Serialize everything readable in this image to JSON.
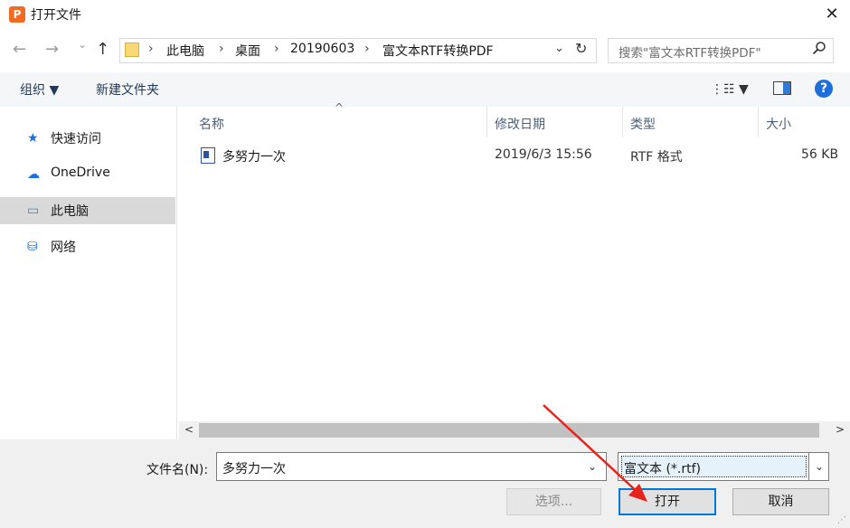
{
  "window": {
    "title": "打开文件",
    "app_icon_letter": "P",
    "app_icon_color": "#f36a21"
  },
  "nav": {
    "back": "←",
    "forward": "→",
    "recent": "⌄",
    "up": "↑",
    "breadcrumb": [
      "此电脑",
      "桌面",
      "20190603",
      "富文本RTF转换PDF"
    ],
    "separator": "›",
    "dropdown": "⌄",
    "refresh": "↻",
    "search_placeholder": "搜索\"富文本RTF转换PDF\"",
    "search_icon": "⌕"
  },
  "toolbar": {
    "organize": "组织 ▼",
    "new_folder": "新建文件夹",
    "view": "⋮☷ ▼",
    "help": "?"
  },
  "sidebar": {
    "items": [
      {
        "label": "快速访问",
        "icon": "★",
        "color": "#1e6fd9"
      },
      {
        "label": "OneDrive",
        "icon": "☁",
        "color": "#1e6fd9"
      },
      {
        "label": "此电脑",
        "icon": "▭",
        "color": "#1e8fd9"
      },
      {
        "label": "网络",
        "icon": "⛁",
        "color": "#1e6fd9"
      }
    ]
  },
  "files": {
    "columns": [
      "名称",
      "修改日期",
      "类型",
      "大小"
    ],
    "sort_caret": "^",
    "rows": [
      {
        "name": "多努力一次",
        "modified": "2019/6/3 15:56",
        "type": "RTF 格式",
        "size": "56 KB"
      }
    ]
  },
  "scrollbar": {
    "left": "<",
    "right": ">"
  },
  "bottom": {
    "filename_label": "文件名(N):",
    "filename_value": "多努力一次",
    "filter_value": "富文本 (*.rtf)",
    "dropdown": "⌄",
    "options_label": "选项...",
    "open_label": "打开",
    "cancel_label": "取消"
  },
  "colors": {
    "accent": "#0078d7",
    "annotation_arrow": "#e8231b",
    "selected_bg": "#d9d9d9"
  }
}
